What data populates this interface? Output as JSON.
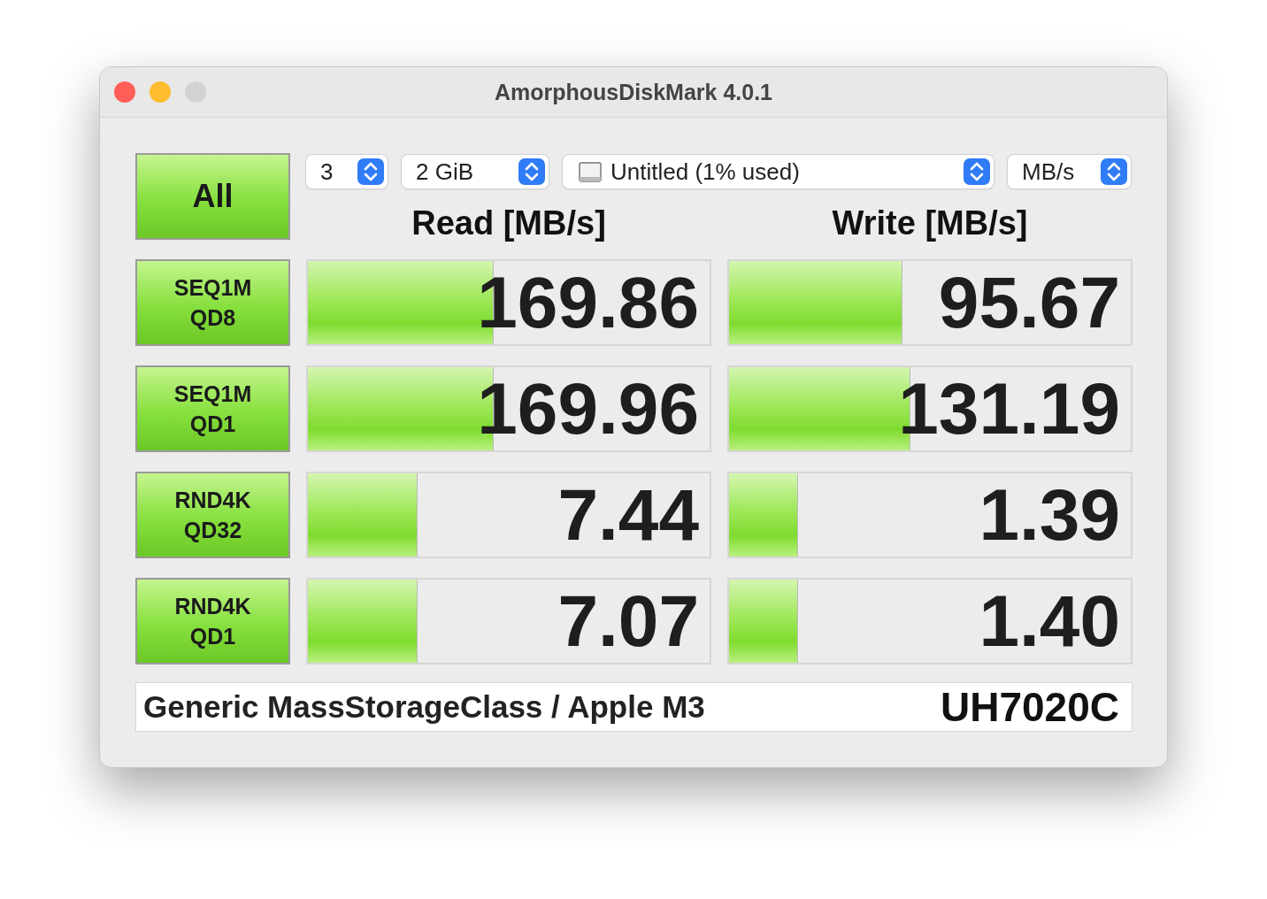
{
  "window": {
    "title": "AmorphousDiskMark 4.0.1"
  },
  "all_button": "All",
  "selectors": [
    {
      "kind": "count",
      "value": "3"
    },
    {
      "kind": "size",
      "value": "2 GiB"
    },
    {
      "kind": "drive",
      "value": "Untitled (1% used)"
    },
    {
      "kind": "unit",
      "value": "MB/s"
    }
  ],
  "headers": [
    "Read [MB/s]",
    "Write [MB/s]"
  ],
  "tests": [
    {
      "label": [
        "SEQ1M",
        "QD8"
      ],
      "read": {
        "value": "169.86",
        "level": 0.46
      },
      "write": {
        "value": "95.67",
        "level": 0.43
      }
    },
    {
      "label": [
        "SEQ1M",
        "QD1"
      ],
      "read": {
        "value": "169.96",
        "level": 0.46
      },
      "write": {
        "value": "131.19",
        "level": 0.45
      }
    },
    {
      "label": [
        "RND4K",
        "QD32"
      ],
      "read": {
        "value": "7.44",
        "level": 0.27
      },
      "write": {
        "value": "1.39",
        "level": 0.17
      }
    },
    {
      "label": [
        "RND4K",
        "QD1"
      ],
      "read": {
        "value": "7.07",
        "level": 0.27
      },
      "write": {
        "value": "1.40",
        "level": 0.17
      }
    }
  ],
  "footer": {
    "device": "Generic MassStorageClass / Apple M3",
    "model": "UH7020C"
  }
}
